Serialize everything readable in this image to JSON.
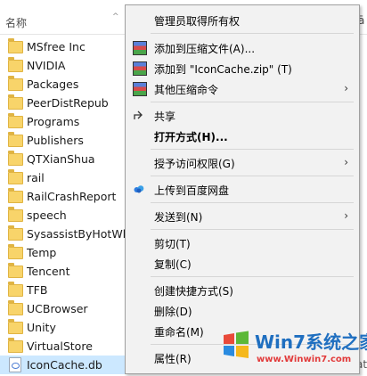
{
  "header": {
    "name_col": "名称",
    "right_col": "ā"
  },
  "files": [
    {
      "label": "MSfree Inc",
      "type": "folder"
    },
    {
      "label": "NVIDIA",
      "type": "folder"
    },
    {
      "label": "Packages",
      "type": "folder"
    },
    {
      "label": "PeerDistRepub",
      "type": "folder"
    },
    {
      "label": "Programs",
      "type": "folder"
    },
    {
      "label": "Publishers",
      "type": "folder"
    },
    {
      "label": "QTXianShua",
      "type": "folder"
    },
    {
      "label": "rail",
      "type": "folder"
    },
    {
      "label": "RailCrashReport",
      "type": "folder"
    },
    {
      "label": "speech",
      "type": "folder"
    },
    {
      "label": "SysassistByHotWheel",
      "type": "folder"
    },
    {
      "label": "Temp",
      "type": "folder"
    },
    {
      "label": "Tencent",
      "type": "folder"
    },
    {
      "label": "TFB",
      "type": "folder"
    },
    {
      "label": "UCBrowser",
      "type": "folder"
    },
    {
      "label": "Unity",
      "type": "folder"
    },
    {
      "label": "VirtualStore",
      "type": "folder"
    },
    {
      "label": "IconCache.db",
      "type": "db",
      "selected": true
    }
  ],
  "right_edge_text": "ata",
  "menu": {
    "items": [
      {
        "label": "管理员取得所有权",
        "bold": false
      },
      {
        "label": "添加到压缩文件(A)...",
        "icon": "winrar-icon"
      },
      {
        "label": "添加到 \"IconCache.zip\" (T)",
        "icon": "winrar-icon"
      },
      {
        "label": "其他压缩命令",
        "icon": "winrar-icon",
        "submenu": true
      },
      {
        "label": "共享",
        "icon": "share-icon"
      },
      {
        "label": "打开方式(H)...",
        "bold": true
      },
      {
        "label": "授予访问权限(G)",
        "submenu": true
      },
      {
        "label": "上传到百度网盘",
        "icon": "baidu-cloud-icon"
      },
      {
        "label": "发送到(N)",
        "submenu": true
      },
      {
        "label": "剪切(T)"
      },
      {
        "label": "复制(C)"
      },
      {
        "label": "创建快捷方式(S)"
      },
      {
        "label": "删除(D)"
      },
      {
        "label": "重命名(M)"
      },
      {
        "label": "属性(R)"
      }
    ]
  },
  "watermark": {
    "title": "Win7系统之家",
    "url": "www.Winwin7.com"
  }
}
